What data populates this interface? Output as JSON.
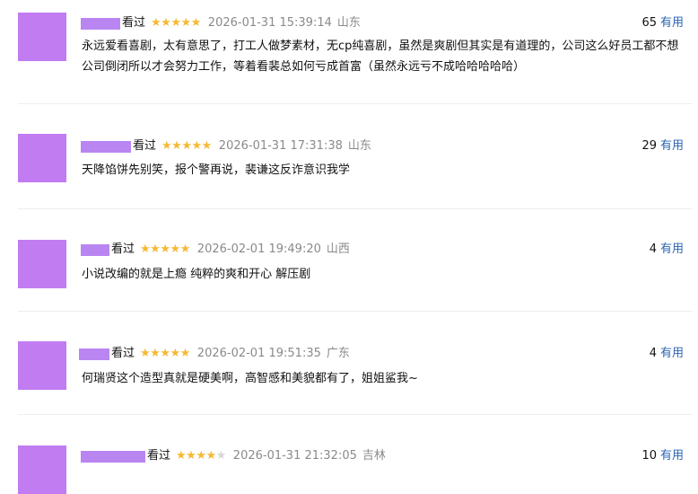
{
  "reviews": [
    {
      "watched": "看过",
      "rating": 5,
      "timestamp": "2026-01-31 15:39:14",
      "location": "山东",
      "votes": "65",
      "useful_label": "有用",
      "comment": "永远爱看喜剧，太有意思了，打工人做梦素材，无cp纯喜剧，虽然是爽剧但其实是有道理的，公司这么好员工都不想公司倒闭所以才会努力工作，等着看裴总如何亏成首富（虽然永远亏不成哈哈哈哈哈）"
    },
    {
      "watched": "看过",
      "rating": 5,
      "timestamp": "2026-01-31 17:31:38",
      "location": "山东",
      "votes": "29",
      "useful_label": "有用",
      "comment": "天降馅饼先别笑，报个警再说，裴谦这反诈意识我学"
    },
    {
      "watched": "看过",
      "rating": 5,
      "timestamp": "2026-02-01 19:49:20",
      "location": "山西",
      "votes": "4",
      "useful_label": "有用",
      "comment": "小说改编的就是上瘾 纯粹的爽和开心 解压剧"
    },
    {
      "watched": "看过",
      "rating": 5,
      "timestamp": "2026-02-01 19:51:35",
      "location": "广东",
      "votes": "4",
      "useful_label": "有用",
      "comment": "何瑞贤这个造型真就是硬美啊，高智感和美貌都有了，姐姐鲨我~"
    },
    {
      "watched": "看过",
      "rating": 4,
      "timestamp": "2026-01-31 21:32:05",
      "location": "吉林",
      "votes": "10",
      "useful_label": "有用",
      "comment": ""
    }
  ]
}
